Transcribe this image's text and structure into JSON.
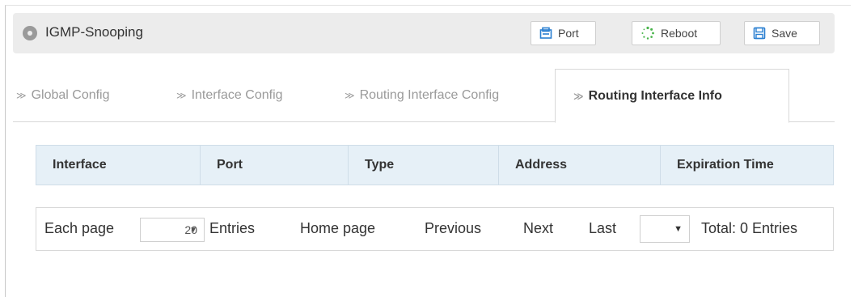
{
  "header": {
    "title": "IGMP-Snooping",
    "buttons": {
      "port": "Port",
      "reboot": "Reboot",
      "save": "Save"
    }
  },
  "tabs": [
    {
      "label": "Global Config",
      "active": false
    },
    {
      "label": "Interface Config",
      "active": false
    },
    {
      "label": "Routing Interface Config",
      "active": false
    },
    {
      "label": "Routing Interface Info",
      "active": true
    }
  ],
  "table": {
    "columns": [
      "Interface",
      "Port",
      "Type",
      "Address",
      "Expiration Time"
    ],
    "rows": []
  },
  "pager": {
    "each_page_label": "Each page",
    "page_size": "20",
    "entries_label": "Entries",
    "home": "Home page",
    "previous": "Previous",
    "next": "Next",
    "last": "Last",
    "jump_value": "",
    "total": "Total: 0 Entries"
  },
  "icons": {
    "title": "circle-icon",
    "port": "port-icon",
    "reboot": "reboot-spinner-icon",
    "save": "floppy-disk-icon",
    "tab_chevron": "chevron-right-icon",
    "dropdown": "caret-down-icon"
  },
  "colors": {
    "accent_blue": "#2a7fd1",
    "reboot_green": "#48b44a",
    "table_header_bg": "#e6f0f7"
  }
}
